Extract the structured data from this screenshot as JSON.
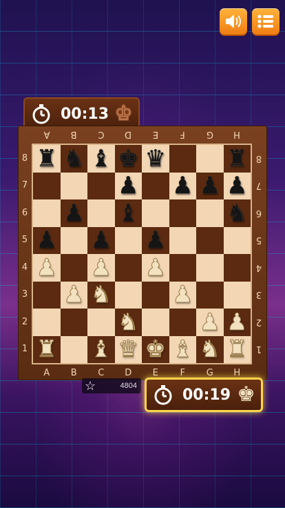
{
  "opponent_timer": {
    "time": "00:13"
  },
  "player_timer": {
    "time": "00:19"
  },
  "score": {
    "value": "4804"
  },
  "files": [
    "A",
    "B",
    "C",
    "D",
    "E",
    "F",
    "G",
    "H"
  ],
  "ranks": [
    "8",
    "7",
    "6",
    "5",
    "4",
    "3",
    "2",
    "1"
  ],
  "board": [
    [
      "bR",
      "bN",
      "bB",
      "bK",
      "bQ",
      "",
      "",
      "bR"
    ],
    [
      "",
      "",
      "",
      "bP",
      "",
      "bP",
      "bP",
      "bP"
    ],
    [
      "",
      "bP",
      "",
      "bB",
      "",
      "",
      "",
      "bN"
    ],
    [
      "bP",
      "",
      "bP",
      "",
      "bP",
      "",
      "",
      ""
    ],
    [
      "wP",
      "",
      "wP",
      "",
      "wP",
      "",
      "",
      ""
    ],
    [
      "",
      "wP",
      "wN",
      "",
      "",
      "wP",
      "",
      ""
    ],
    [
      "",
      "",
      "",
      "wN",
      "",
      "",
      "wP",
      "wP"
    ],
    [
      "wR",
      "",
      "wB",
      "wQ",
      "wK",
      "wB",
      "wN",
      "wR"
    ]
  ],
  "icons": {
    "sound": "speaker-icon",
    "menu": "menu-list-icon",
    "clock": "stopwatch-icon",
    "king": "king-icon",
    "star": "star-icon"
  },
  "colors": {
    "accent": "#f07d13",
    "highlight": "#ffd54a"
  }
}
